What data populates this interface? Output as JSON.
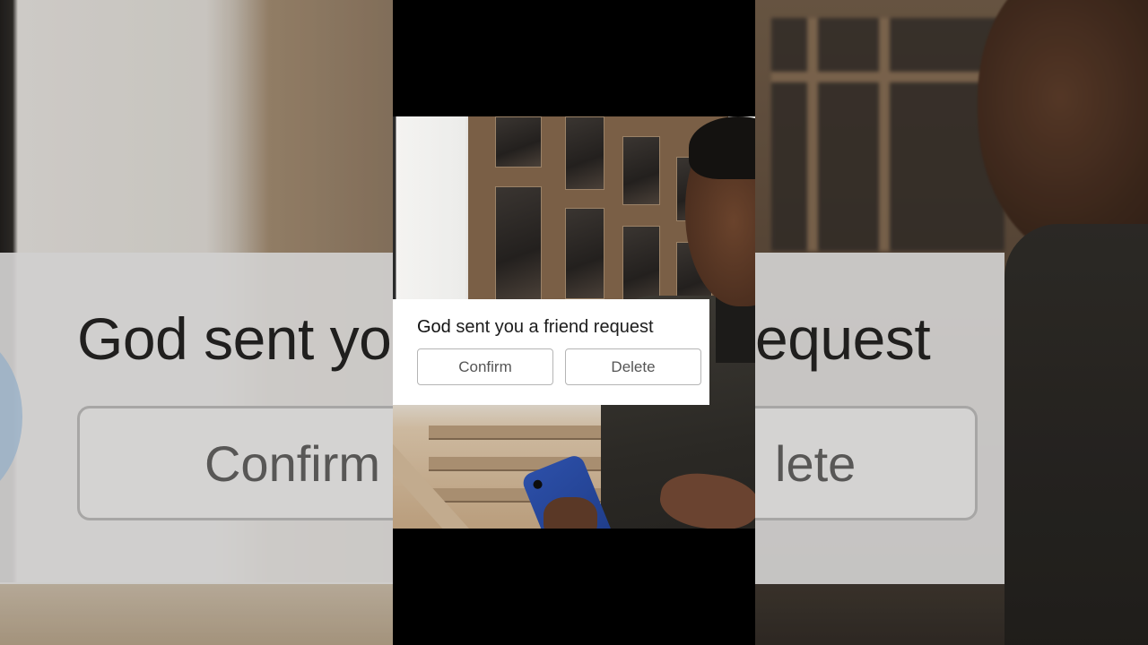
{
  "notification": {
    "sender": "God",
    "message": " sent you a friend request",
    "confirm_label": "Confirm",
    "delete_label": "Delete"
  },
  "backdrop": {
    "title_prefix": "God",
    "title_rest": " sent yo",
    "title_tail": "equest",
    "confirm_partial": "Confirm",
    "delete_partial": "lete"
  },
  "colors": {
    "card_background": "#ffffff",
    "button_border": "#b5b5b5",
    "button_text": "#555555",
    "letterbox": "#000000"
  }
}
